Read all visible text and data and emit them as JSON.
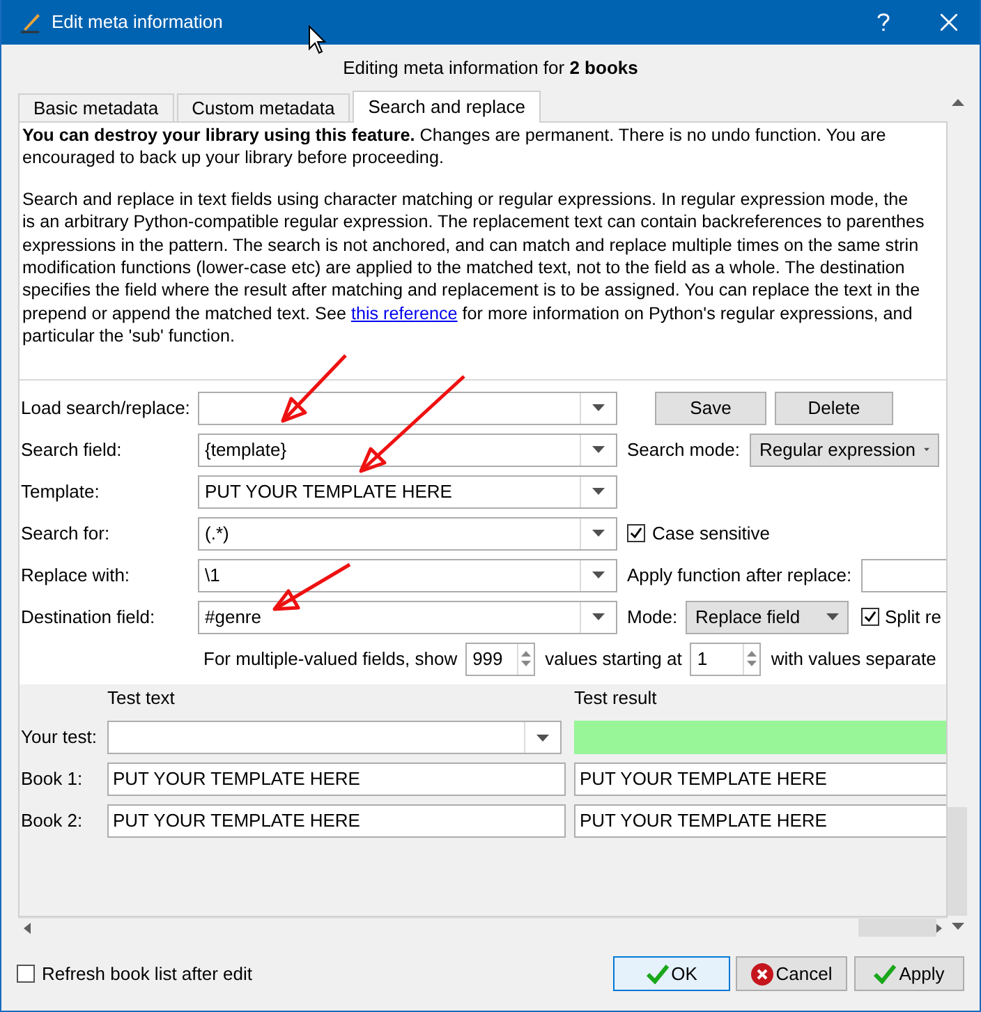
{
  "window": {
    "title": "Edit meta information"
  },
  "header": "Editing meta information for **2 books**",
  "tabs": [
    {
      "label": "Basic metadata",
      "selected": false
    },
    {
      "label": "Custom metadata",
      "selected": false
    },
    {
      "label": "Search and replace",
      "selected": true
    }
  ],
  "warning": [
    "**You can destroy your library using this feature.** Changes are permanent. There is no undo function. You are",
    "encouraged to back up your library before proceeding."
  ],
  "description": [
    [
      {
        "text": "Search and replace in text fields using character matching or regular expressions. In regular expression mode, the"
      }
    ],
    [
      {
        "text": "is an arbitrary Python-compatible regular expression. The replacement text can contain backreferences to parenthes"
      }
    ],
    [
      {
        "text": "expressions in the pattern. The search is not anchored, and can match and replace multiple times on the same strin"
      }
    ],
    [
      {
        "text": "modification functions (lower-case etc) are applied to the matched text, not to the field as a whole. The destination"
      }
    ],
    [
      {
        "text": "specifies the field where the result after matching and replacement is to be assigned. You can replace the text in the"
      }
    ],
    [
      {
        "text": "prepend or append the matched text. See "
      },
      {
        "text": "this reference",
        "link": true
      },
      {
        "text": " for more information on Python's regular expressions, and"
      }
    ],
    [
      {
        "text": "particular the 'sub' function."
      }
    ]
  ],
  "form": {
    "load": {
      "label": "Load search/replace:",
      "buttons": [
        "Save",
        "Delete"
      ]
    },
    "search_field": {
      "label": "Search field:",
      "value": "{template}"
    },
    "search_mode": {
      "label": "Search mode:",
      "value": "Regular expression"
    },
    "template": {
      "label": "Template:",
      "value": "PUT YOUR TEMPLATE HERE"
    },
    "search_for": {
      "label": "Search for:",
      "value": "(.*)"
    },
    "case_sensitive": {
      "label": "Case sensitive",
      "checked": true
    },
    "replace_with": {
      "label": "Replace with:",
      "value": "\\1"
    },
    "apply_function": {
      "label": "Apply function after replace:"
    },
    "destination_field": {
      "label": "Destination field:",
      "value": "#genre"
    },
    "mode": {
      "label": "Mode:",
      "value": "Replace field"
    },
    "split_result": {
      "label": "Split re",
      "checked": true
    },
    "multiple_values": {
      "show_label": "For multiple-valued fields, show",
      "show_value": "999",
      "start_label": "values starting at",
      "start_value": "1",
      "separator_label": "with values separate"
    }
  },
  "test": {
    "columns": [
      "Test text",
      "Test result"
    ],
    "rows": [
      {
        "label": "Your test:",
        "kind": "your_test"
      },
      {
        "label": "Book 1:",
        "kind": "book",
        "test_text": "PUT YOUR TEMPLATE HERE",
        "test_result": "PUT YOUR TEMPLATE HERE"
      },
      {
        "label": "Book 2:",
        "kind": "book",
        "test_text": "PUT YOUR TEMPLATE HERE",
        "test_result": "PUT YOUR TEMPLATE HERE"
      }
    ]
  },
  "footer": {
    "refresh": {
      "label": "Refresh book list after edit",
      "checked": false
    },
    "buttons": [
      {
        "label": "OK",
        "kind": "ok",
        "default": true
      },
      {
        "label": "Cancel",
        "kind": "cancel",
        "default": false
      },
      {
        "label": "Apply",
        "kind": "apply",
        "default": false
      }
    ]
  }
}
